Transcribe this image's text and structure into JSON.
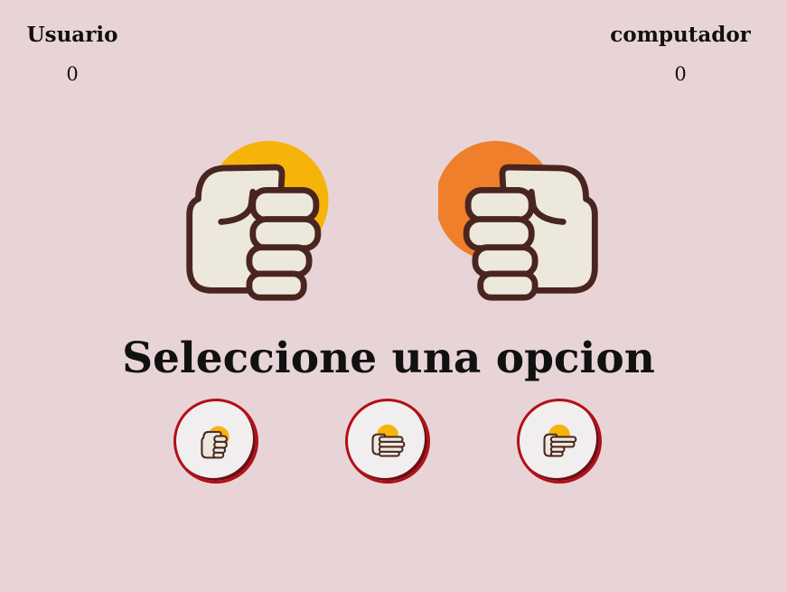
{
  "scoreboard": {
    "user_label": "Usuario",
    "user_score": "0",
    "computer_label": "computador",
    "computer_score": "0"
  },
  "prompt": "Seleccione una opcion",
  "hands": {
    "player": {
      "icon": "rock-fist-icon",
      "accent_color": "#f6b40b"
    },
    "computer": {
      "icon": "rock-fist-icon",
      "accent_color": "#ef7f2a"
    }
  },
  "options": [
    {
      "name": "rock",
      "icon": "rock-hand-icon"
    },
    {
      "name": "paper",
      "icon": "paper-hand-icon"
    },
    {
      "name": "scissors",
      "icon": "scissors-hand-icon"
    }
  ],
  "colors": {
    "background": "#e8d4d6",
    "button_border": "#b20f16",
    "hand_fill": "#ede8dc",
    "hand_outline": "#4a2520",
    "sun_yellow": "#f6b40b",
    "sun_orange": "#ef7f2a"
  }
}
